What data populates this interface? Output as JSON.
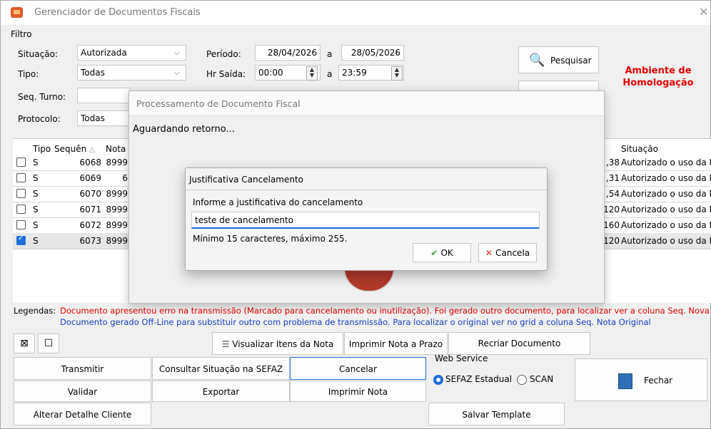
{
  "window": {
    "title": "Gerenciador de Documentos Fiscais"
  },
  "filter": {
    "group_label": "Filtro",
    "situacao_label": "Situação:",
    "situacao_value": "Autorizada",
    "tipo_label": "Tipo:",
    "tipo_value": "Todas",
    "seq_turno_label": "Seq. Turno:",
    "protocolo_label": "Protocolo:",
    "protocolo_value": "Todas",
    "periodo_label": "Período:",
    "periodo_from": "28/04/2026",
    "periodo_sep": "a",
    "periodo_to": "28/05/2026",
    "hr_saida_label": "Hr Saída:",
    "hr_from": "00:00",
    "hr_sep": "a",
    "hr_to": "23:59"
  },
  "pesquisar_label": "Pesquisar",
  "ambiente_label": "Ambiente de Homologação",
  "grid": {
    "headers": {
      "tipo": "Tipo",
      "sequencia": "Sequên",
      "nota": "Nota",
      "situacao": "Situação"
    },
    "rows": [
      {
        "checked": false,
        "tipo": "S",
        "seq": "6068",
        "nota": "8999",
        "valor": ",38",
        "situacao": "Autorizado o uso da NF"
      },
      {
        "checked": false,
        "tipo": "S",
        "seq": "6069",
        "nota": "6",
        "valor": ",31",
        "situacao": "Autorizado o uso da NF"
      },
      {
        "checked": false,
        "tipo": "S",
        "seq": "6070",
        "nota": "8999",
        "valor": ",54",
        "situacao": "Autorizado o uso da NF"
      },
      {
        "checked": false,
        "tipo": "S",
        "seq": "6071",
        "nota": "8999",
        "valor": "120",
        "situacao": "Autorizado o uso da NF"
      },
      {
        "checked": false,
        "tipo": "S",
        "seq": "6072",
        "nota": "8999",
        "valor": "160",
        "situacao": "Autorizado o uso da NF"
      },
      {
        "checked": true,
        "tipo": "S",
        "seq": "6073",
        "nota": "8999",
        "valor": "120",
        "situacao": "Autorizado o uso da NF"
      }
    ]
  },
  "legend": {
    "label": "Legendas:",
    "line1": "Documento apresentou erro na transmissão (Marcado para cancelamento ou inutilização). Foi gerado outro documento, para localizar ver a coluna Seq. Nova Nota",
    "line2": "Documento gerado Off-Line para substituir outro com problema  de transmissão. Para localizar o original ver no grid a coluna Seq. Nota Original"
  },
  "buttons": {
    "visualizar": "Visualizar Itens da Nota",
    "imprimir_prazo": "Imprimir Nota a Prazo",
    "recriar": "Recriar Documento",
    "transmitir": "Transmitir",
    "consultar": "Consultar Situação na SEFAZ",
    "cancelar": "Cancelar",
    "validar": "Validar",
    "exportar": "Exportar",
    "imprimir": "Imprimir Nota",
    "alterar": "Alterar Detalhe Cliente",
    "salvar_template": "Salvar Template",
    "fechar": "Fechar"
  },
  "web_service": {
    "label": "Web Service",
    "opt1": "SEFAZ Estadual",
    "opt2": "SCAN"
  },
  "proc_dialog": {
    "title": "Processamento de Documento Fiscal",
    "message": "Aguardando retorno..."
  },
  "just_dialog": {
    "title": "Justificativa Cancelamento",
    "prompt": "Informe a justificativa do cancelamento",
    "value": "teste de cancelamento",
    "hint": "Mínimo 15 caracteres, máximo 255.",
    "ok": "OK",
    "cancel": "Cancela"
  },
  "colors": {
    "accent": "#1e6fd9",
    "error_text": "#e00000",
    "info_text": "#1a3fc0"
  }
}
